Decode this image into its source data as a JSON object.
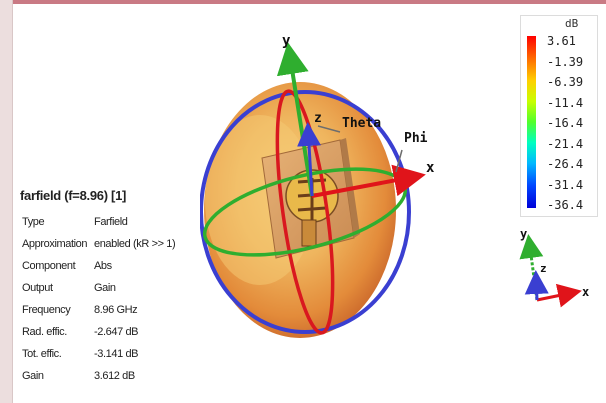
{
  "scene": {
    "axes": {
      "x": "x",
      "y": "y",
      "z": "z",
      "theta": "Theta",
      "phi": "Phi"
    },
    "mini_axes": {
      "x": "x",
      "y": "y",
      "z": "z"
    }
  },
  "info_panel": {
    "title": "farfield (f=8.96) [1]",
    "rows": [
      {
        "key": "Type",
        "value": "Farfield"
      },
      {
        "key": "Approximation",
        "value": "enabled (kR >> 1)"
      },
      {
        "key": "Component",
        "value": "Abs"
      },
      {
        "key": "Output",
        "value": "Gain"
      },
      {
        "key": "Frequency",
        "value": "8.96 GHz"
      },
      {
        "key": "Rad. effic.",
        "value": "-2.647 dB"
      },
      {
        "key": "Tot. effic.",
        "value": "-3.141 dB"
      },
      {
        "key": "Gain",
        "value": "3.612 dB"
      }
    ]
  },
  "legend": {
    "unit": "dB",
    "labels": [
      "3.61",
      "-1.39",
      "-6.39",
      "-11.4",
      "-16.4",
      "-21.4",
      "-26.4",
      "-31.4",
      "-36.4"
    ]
  },
  "colors": {
    "x_axis": "#e0141a",
    "y_axis": "#2fae2f",
    "z_axis": "#3a3fd1",
    "pattern": "#e8a24a"
  }
}
